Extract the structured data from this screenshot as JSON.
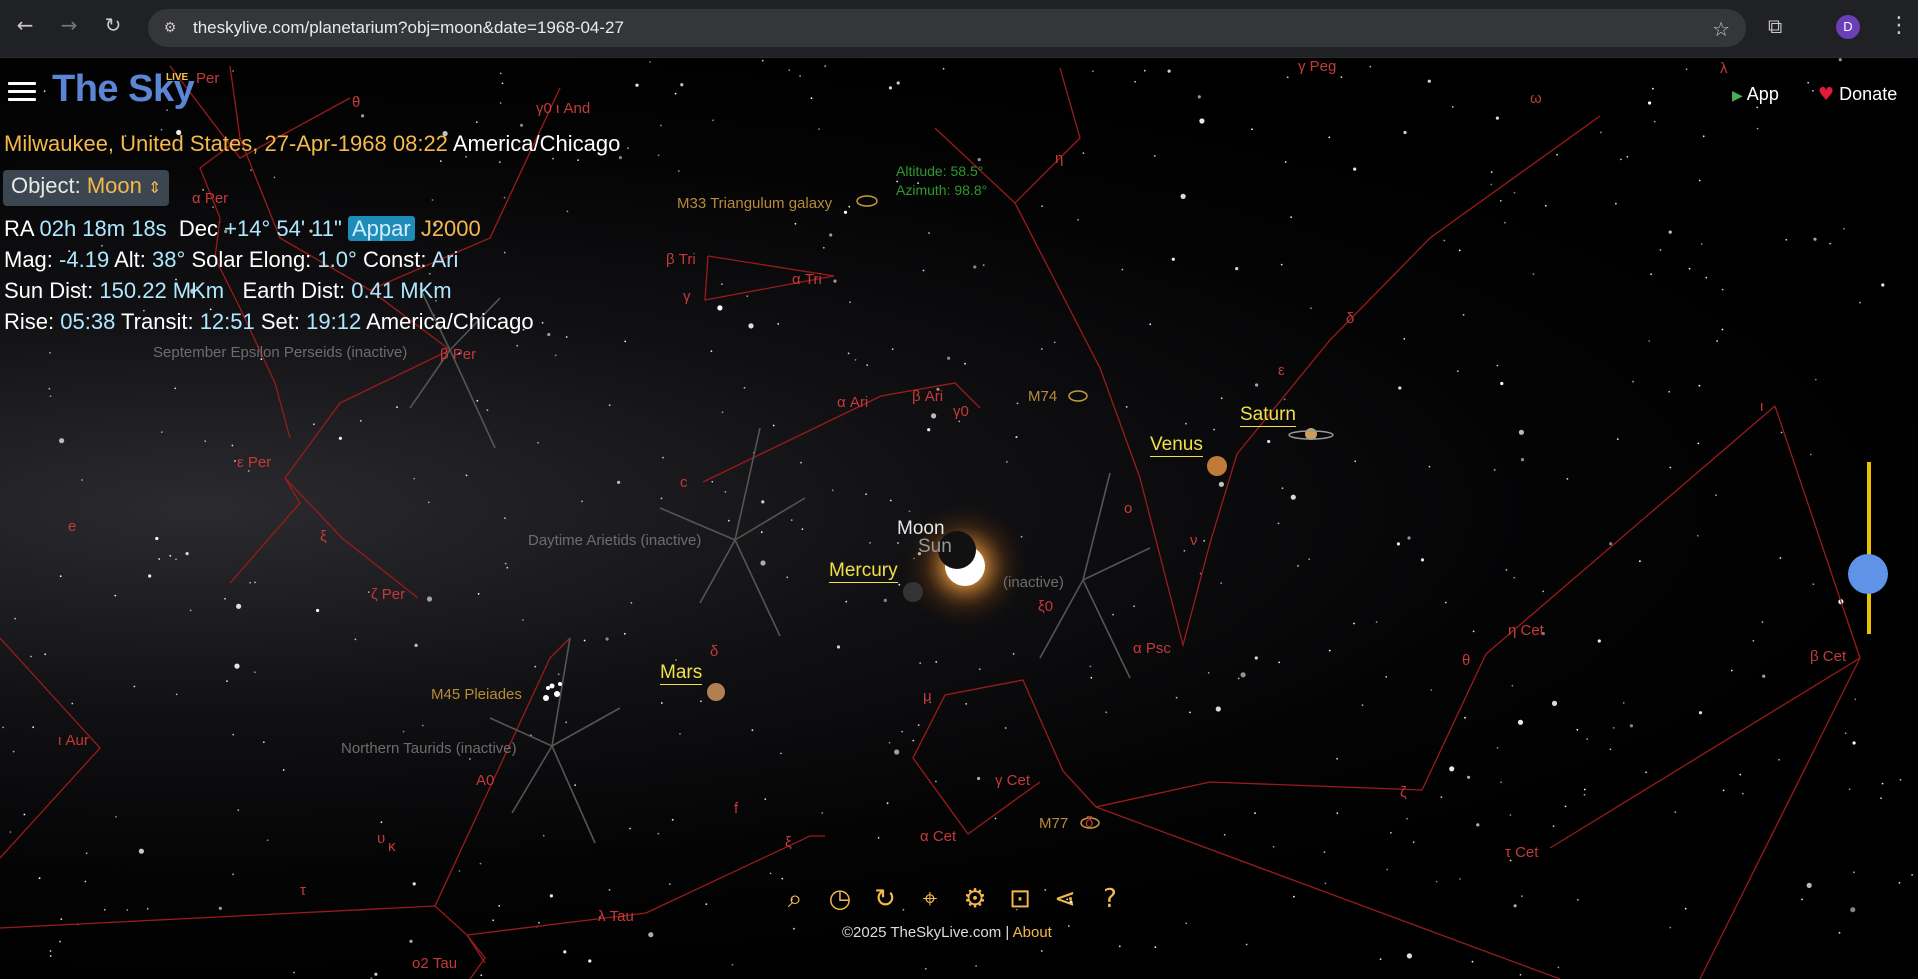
{
  "browser": {
    "url": "theskylive.com/planetarium?obj=moon&date=1968-04-27",
    "profile_initial": "D",
    "icons": {
      "back": "back-arrow-icon",
      "forward": "forward-arrow-icon",
      "reload": "reload-icon",
      "site_info": "site-info-icon",
      "bookmark": "star-icon",
      "extensions": "puzzle-icon",
      "menu": "kebab-menu-icon"
    }
  },
  "header": {
    "logo_text": "The Sky",
    "logo_badge": "LIVE",
    "app_label": "App",
    "donate_label": "Donate"
  },
  "info": {
    "location": "Milwaukee, United States, 27-Apr-1968 08:22",
    "timezone": "America/Chicago",
    "object_label": "Object:",
    "object_value": "Moon",
    "ra_label": "RA",
    "ra_value": "02h 18m 18s",
    "dec_label": "Dec",
    "dec_value": "+14° 54' 11\"",
    "appar_label": "Appar",
    "j2000_label": "J2000",
    "mag_label": "Mag:",
    "mag_value": "-4.19",
    "alt_label": "Alt:",
    "alt_value": "38°",
    "elong_label": "Solar Elong:",
    "elong_value": "1.0°",
    "const_label": "Const:",
    "const_value": "Ari",
    "sun_dist_label": "Sun Dist:",
    "sun_dist_value": "150.22 MKm",
    "earth_dist_label": "Earth Dist:",
    "earth_dist_value": "0.41 MKm",
    "rise_label": "Rise:",
    "rise_value": "05:38",
    "transit_label": "Transit:",
    "transit_value": "12:51",
    "set_label": "Set:",
    "set_value": "19:12",
    "set_tz": "America/Chicago"
  },
  "sky": {
    "altaz": {
      "altitude": "Altitude: 58.5°",
      "azimuth": "Azimuth: 98.8°"
    },
    "planets": {
      "moon": "Moon",
      "sun": "Sun",
      "mercury": "Mercury",
      "venus": "Venus",
      "saturn": "Saturn",
      "mars": "Mars"
    },
    "deep_sky": {
      "m33": "M33 Triangulum galaxy",
      "m74": "M74",
      "m45": "M45 Pleiades",
      "m77": "M77"
    },
    "showers": {
      "daytime_arietids": "Daytime Arietids (inactive)",
      "sept_epsilon": "September Epsilon Perseids (inactive)",
      "northern_taurids": "Northern Taurids (inactive)",
      "unknown": "(inactive)"
    },
    "stars": {
      "g_peg": "γ Peg",
      "b_tri": "β Tri",
      "a_tri": "α Tri",
      "g_tri": "γ",
      "a_ari": "α Ari",
      "b_ari": "β Ari",
      "g0": "γ0",
      "a_psc": "α Psc",
      "e_per": "ε Per",
      "z_per": "ζ Per",
      "a_per": "α Per",
      "b_per": "β Per",
      "i_aur": "ι Aur",
      "eta_cet": "η Cet",
      "b_cet": "β Cet",
      "g_cet": "γ Cet",
      "a_cet": "α Cet",
      "t_cet": "τ Cet",
      "theta": "θ",
      "zeta": "ζ",
      "l_tau": "λ Tau",
      "x0": "ξ0",
      "xi_tau": "ξ",
      "o2_tau": "ο2 Tau",
      "a0": "A0",
      "e": "e",
      "mu": "μ",
      "delta": "δ",
      "epsilon": "ε",
      "nu": "ν",
      "omicron": "ο",
      "eta": "η",
      "iota": "ι",
      "omega": "ω",
      "kappa": "κ",
      "upsilon": "υ",
      "f": "f",
      "c": "c",
      "eta_per": "η",
      "theta_per": "θ",
      "lambda": "λ",
      "tau": "τ",
      "gamma": "γ",
      "xi_per": "ξ",
      "y_and": "γ0 ι And",
      "per_top": "Per"
    }
  },
  "toolbar": {
    "icons": [
      "search-icon",
      "clock-icon",
      "time-travel-icon",
      "location-pin-icon",
      "gear-icon",
      "camera-icon",
      "share-icon",
      "help-icon"
    ]
  },
  "footer": {
    "copyright": "©2025 TheSkyLive.com",
    "separator": "|",
    "about": "About"
  },
  "colors": {
    "accent": "#f5b84a",
    "logo": "#5b86d6",
    "constellation": "#b02020",
    "planet_label": "#f0e04a",
    "zoom_knob": "#5f93e8"
  }
}
